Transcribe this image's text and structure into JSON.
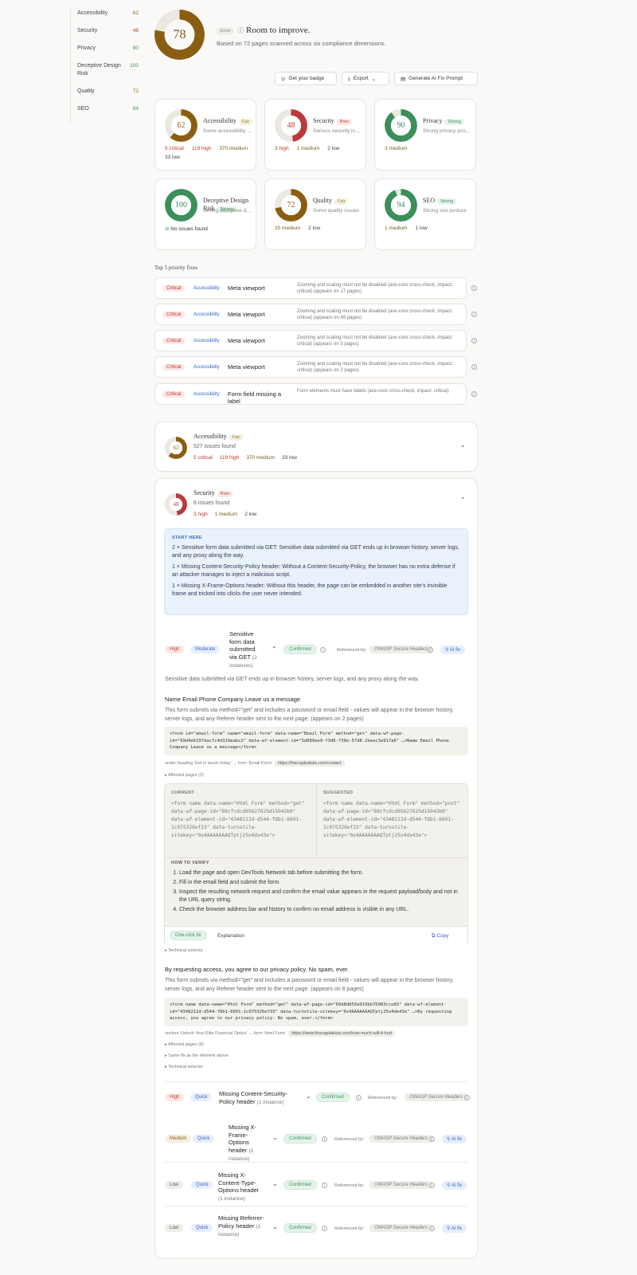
{
  "sidebar": {
    "items": [
      {
        "label": "Accessibility",
        "score": "62",
        "level": "fair"
      },
      {
        "label": "Security",
        "score": "48",
        "level": "poor"
      },
      {
        "label": "Privacy",
        "score": "90",
        "level": "strong"
      },
      {
        "label": "Deceptive Design Risk",
        "score": "100",
        "level": "strong"
      },
      {
        "label": "Quality",
        "score": "72",
        "level": "fair"
      },
      {
        "label": "SEO",
        "score": "94",
        "level": "strong"
      }
    ]
  },
  "hero": {
    "score": "78",
    "score_fraction": 0.78,
    "badge": "Good",
    "heading": "Room to improve.",
    "subtitle": "Based on 72 pages scanned across six compliance dimensions."
  },
  "actions": {
    "badge": "Get your badge",
    "export": "Export",
    "ai_prompt": "Generate AI Fix Prompt"
  },
  "cards": [
    {
      "name": "Accessibility",
      "pill": "Fair",
      "score": "62",
      "fraction": 0.62,
      "desc": "Some accessibility issues",
      "stats": [
        {
          "text": "5 critical",
          "cls": "c-crit"
        },
        {
          "text": "119 high",
          "cls": "c-high"
        },
        {
          "text": "370 medium",
          "cls": "c-med"
        },
        {
          "text": "33 low",
          "cls": "c-low"
        }
      ]
    },
    {
      "name": "Security",
      "pill": "Poor",
      "score": "48",
      "fraction": 0.48,
      "desc": "Serious security issues",
      "stats": [
        {
          "text": "3 high",
          "cls": "c-high"
        },
        {
          "text": "1 medium",
          "cls": "c-med"
        },
        {
          "text": "2 low",
          "cls": "c-low"
        }
      ]
    },
    {
      "name": "Privacy",
      "pill": "Strong",
      "score": "90",
      "fraction": 0.9,
      "desc": "Strong privacy posture",
      "stats": [
        {
          "text": "3 medium",
          "cls": "c-med"
        }
      ]
    },
    {
      "name": "Deceptive Design Risk",
      "pill": "Strong",
      "score": "100",
      "fraction": 1.0,
      "desc": "Strong deceptive design",
      "stats": [
        {
          "text": "No issues found",
          "cls": "c-ok"
        }
      ]
    },
    {
      "name": "Quality",
      "pill": "Fair",
      "score": "72",
      "fraction": 0.72,
      "desc": "Some quality issues",
      "stats": [
        {
          "text": "20 medium",
          "cls": "c-med"
        },
        {
          "text": "2 low",
          "cls": "c-low"
        }
      ]
    },
    {
      "name": "SEO",
      "pill": "Strong",
      "score": "94",
      "fraction": 0.94,
      "desc": "Strong seo posture",
      "stats": [
        {
          "text": "1 medium",
          "cls": "c-med"
        },
        {
          "text": "1 low",
          "cls": "c-low"
        }
      ]
    }
  ],
  "priority": {
    "title": "Top 5 priority fixes",
    "rows": [
      {
        "sev": "Critical",
        "cat": "Accessibility",
        "title": "Meta viewport",
        "desc": "Zooming and scaling must not be disabled (axe-core cross-check, impact: critical) (appears on 17 pages)"
      },
      {
        "sev": "Critical",
        "cat": "Accessibility",
        "title": "Meta viewport",
        "desc": "Zooming and scaling must not be disabled (axe-core cross-check, impact: critical) (appears on 48 pages)"
      },
      {
        "sev": "Critical",
        "cat": "Accessibility",
        "title": "Meta viewport",
        "desc": "Zooming and scaling must not be disabled (axe-core cross-check, impact: critical) (appears on 5 pages)"
      },
      {
        "sev": "Critical",
        "cat": "Accessibility",
        "title": "Meta viewport",
        "desc": "Zooming and scaling must not be disabled (axe-core cross-check, impact: critical) (appears on 2 pages)"
      },
      {
        "sev": "Critical",
        "cat": "Accessibility",
        "title": "Form field missing a label",
        "desc": "Form elements must have labels (axe-core cross-check, impact: critical)"
      }
    ]
  },
  "acc_panel": {
    "name": "Accessibility",
    "pill": "Fair",
    "score": "62",
    "fraction": 0.62,
    "count": "527 issues found",
    "s1": "5 critical",
    "s2": "119 high",
    "s3": "370 medium",
    "s4": "33 low"
  },
  "sec_panel": {
    "name": "Security",
    "pill": "Poor",
    "score": "48",
    "fraction": 0.48,
    "count": "6 issues found",
    "s1": "3 high",
    "s2": "1 medium",
    "s3": "2 low"
  },
  "start_here": {
    "label": "START HERE",
    "items": [
      "2 × Sensitive form data submitted via GET: Sensitive data submitted via GET ends up in browser history, server logs, and any proxy along the way.",
      "1 × Missing Content-Security-Policy header: Without a Content-Security-Policy, the browser has no extra defense if an attacker manages to inject a malicious script.",
      "1 × Missing X-Frame-Options header: Without this header, the page can be embedded in another site's invisible frame and tricked into clicks the user never intended."
    ]
  },
  "issue1": {
    "sev": "High",
    "effort": "Moderate",
    "title": "Sensitive form data submitted via GET",
    "inst": "(2 instances)",
    "status": "Confirmed",
    "ref_label": "Referenced by:",
    "ref": "OWASP Secure Headers",
    "ai": "AI fix",
    "desc": "Sensitive data submitted via GET ends up in browser history, server logs, and any proxy along the way.",
    "inst1": {
      "heading": "Name Email Phone Company Leave us a message",
      "text": "This form submits via method=\"get\" and includes a password or email field - values will appear in the browser history, server logs, and any Referer header sent to the next page. (appears on 2 pages)",
      "code": "<form id=\"email-form\" name=\"email-form\" data-name=\"Email Form\" method=\"get\" data-wf-page-id=\"69d4e6197dacfc4d319eabc2\" data-wf-element-id=\"5d089ee9-f3d6-739e-57d8-2beec3a917a6\" …>Name Email Phone Company Leave us a message</form>",
      "loc": "under heading 'Get in touch today' → form 'Email Form'",
      "url": "https://thecapitalista.com/contact",
      "affected": "Affected pages (2)"
    },
    "diff": {
      "current_label": "CURRENT",
      "current": "<form name data-name=\"Html Form\" method=\"get\" data-wf-page-id=\"69cfcdcd05627625d15043b0\" data-wf-element-id=\"4348212d-d544-f8b1-6601-1c075326ef33\" data-turnstile-sitekey=\"0x4AAAAAAAQTptj25o4dx43e\">",
      "suggested_label": "SUGGESTED",
      "suggested": "<form name data-name=\"Html Form\" method=\"post\" data-wf-page-id=\"69cfcdcd05627625d15043b0\" data-wf-element-id=\"4348212d-d544-f8b1-6601-1c075326ef33\" data-turnstile-sitekey=\"0x4AAAAAAAQTptj25o4dx43e\">",
      "verify_label": "HOW TO VERIFY",
      "steps": [
        "Load the page and open DevTools Network tab before submitting the form.",
        "Fill in the email field and submit the form.",
        "Inspect the resulting network request and confirm the email value appears in the request payload/body and not in the URL query string.",
        "Check the browser address bar and history to confirm no email address is visible in any URL."
      ],
      "oneclick": "One-click fix",
      "explanation": "Explanation",
      "copy": "Copy"
    },
    "tech": "Technical selector",
    "inst2": {
      "heading": "By requesting access, you agree to our privacy policy. No spam, ever.",
      "text": "This form submits via method=\"get\" and includes a password or email field - values will appear in the browser history, server logs, and any Referer header sent to the next page. (appears on 8 pages)",
      "code": "<form name data-name=\"Html Form\" method=\"get\" data-wf-page-id=\"69d8d859a919bb76083cce83\" data-wf-element-id=\"4348212d-d544-f8b1-6601-1c075326ef33\" data-turnstile-sitekey=\"0x4AAAAAAAQTptj25o4de43e\" …>By requesting access, you agree to our privacy policy. No spam, ever.</form>",
      "loc": "section 'Unlock Your Elite Financial Optics' → form 'Html Form'",
      "url": "https://www.thecapitalista.com/how-much-will-it-hurt",
      "affected": "Affected pages (8)",
      "same": "Same fix as the element above",
      "tech": "Technical selector"
    }
  },
  "issues": [
    {
      "sev": "High",
      "sevcls": "high",
      "effort": "Quick",
      "title": "Missing Content-Security-Policy header",
      "inst": "(1 instance)",
      "status": "Confirmed",
      "ref_label": "Referenced by:",
      "ref": "OWASP Secure Headers",
      "ai": ""
    },
    {
      "sev": "Medium",
      "sevcls": "medium",
      "effort": "Quick",
      "title": "Missing X-Frame-Options header",
      "inst": "(1 instance)",
      "status": "Confirmed",
      "ref_label": "Referenced by:",
      "ref": "OWASP Secure Headers",
      "ai": "AI fix"
    },
    {
      "sev": "Low",
      "sevcls": "low",
      "effort": "Quick",
      "title": "Missing X-Content-Type-Options header",
      "inst": "(1 instance)",
      "status": "Confirmed",
      "ref_label": "Referenced by:",
      "ref": "OWASP Secure Headers",
      "ai": "AI fix"
    },
    {
      "sev": "Low",
      "sevcls": "low",
      "effort": "Quick",
      "title": "Missing Referrer-Policy header",
      "inst": "(1 instance)",
      "status": "Confirmed",
      "ref_label": "Referenced by:",
      "ref": "OWASP Secure Headers",
      "ai": "AI fix"
    }
  ],
  "colors": {
    "fair": "#8a5e12",
    "poor": "#b83a3a",
    "strong": "#3b8f5a",
    "track": "#ebe8e2",
    "accent": "#3765c8"
  }
}
